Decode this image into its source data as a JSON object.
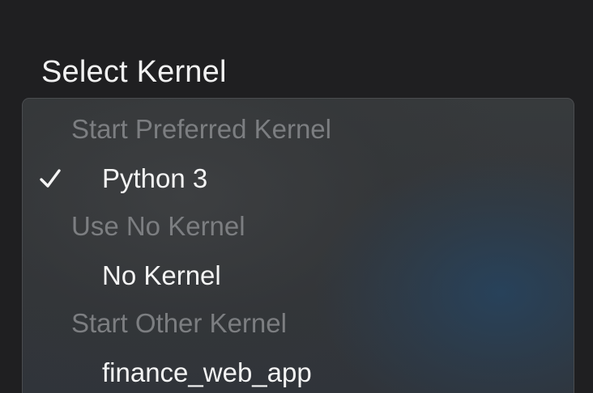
{
  "dialog": {
    "title": "Select Kernel"
  },
  "kernel_menu": {
    "sections": [
      {
        "header": "Start Preferred Kernel",
        "items": [
          {
            "label": "Python 3",
            "selected": true,
            "icon": "checkmark-icon"
          }
        ]
      },
      {
        "header": "Use No Kernel",
        "items": [
          {
            "label": "No Kernel",
            "selected": false
          }
        ]
      },
      {
        "header": "Start Other Kernel",
        "items": [
          {
            "label": "finance_web_app",
            "selected": false
          }
        ]
      }
    ]
  },
  "colors": {
    "background": "#1f1f21",
    "menu_background": "#35383b",
    "menu_border": "#4a4c4f",
    "section_header_text": "#7c7e81",
    "item_text": "#f4f4f4",
    "title_text": "#f2f2f2"
  }
}
